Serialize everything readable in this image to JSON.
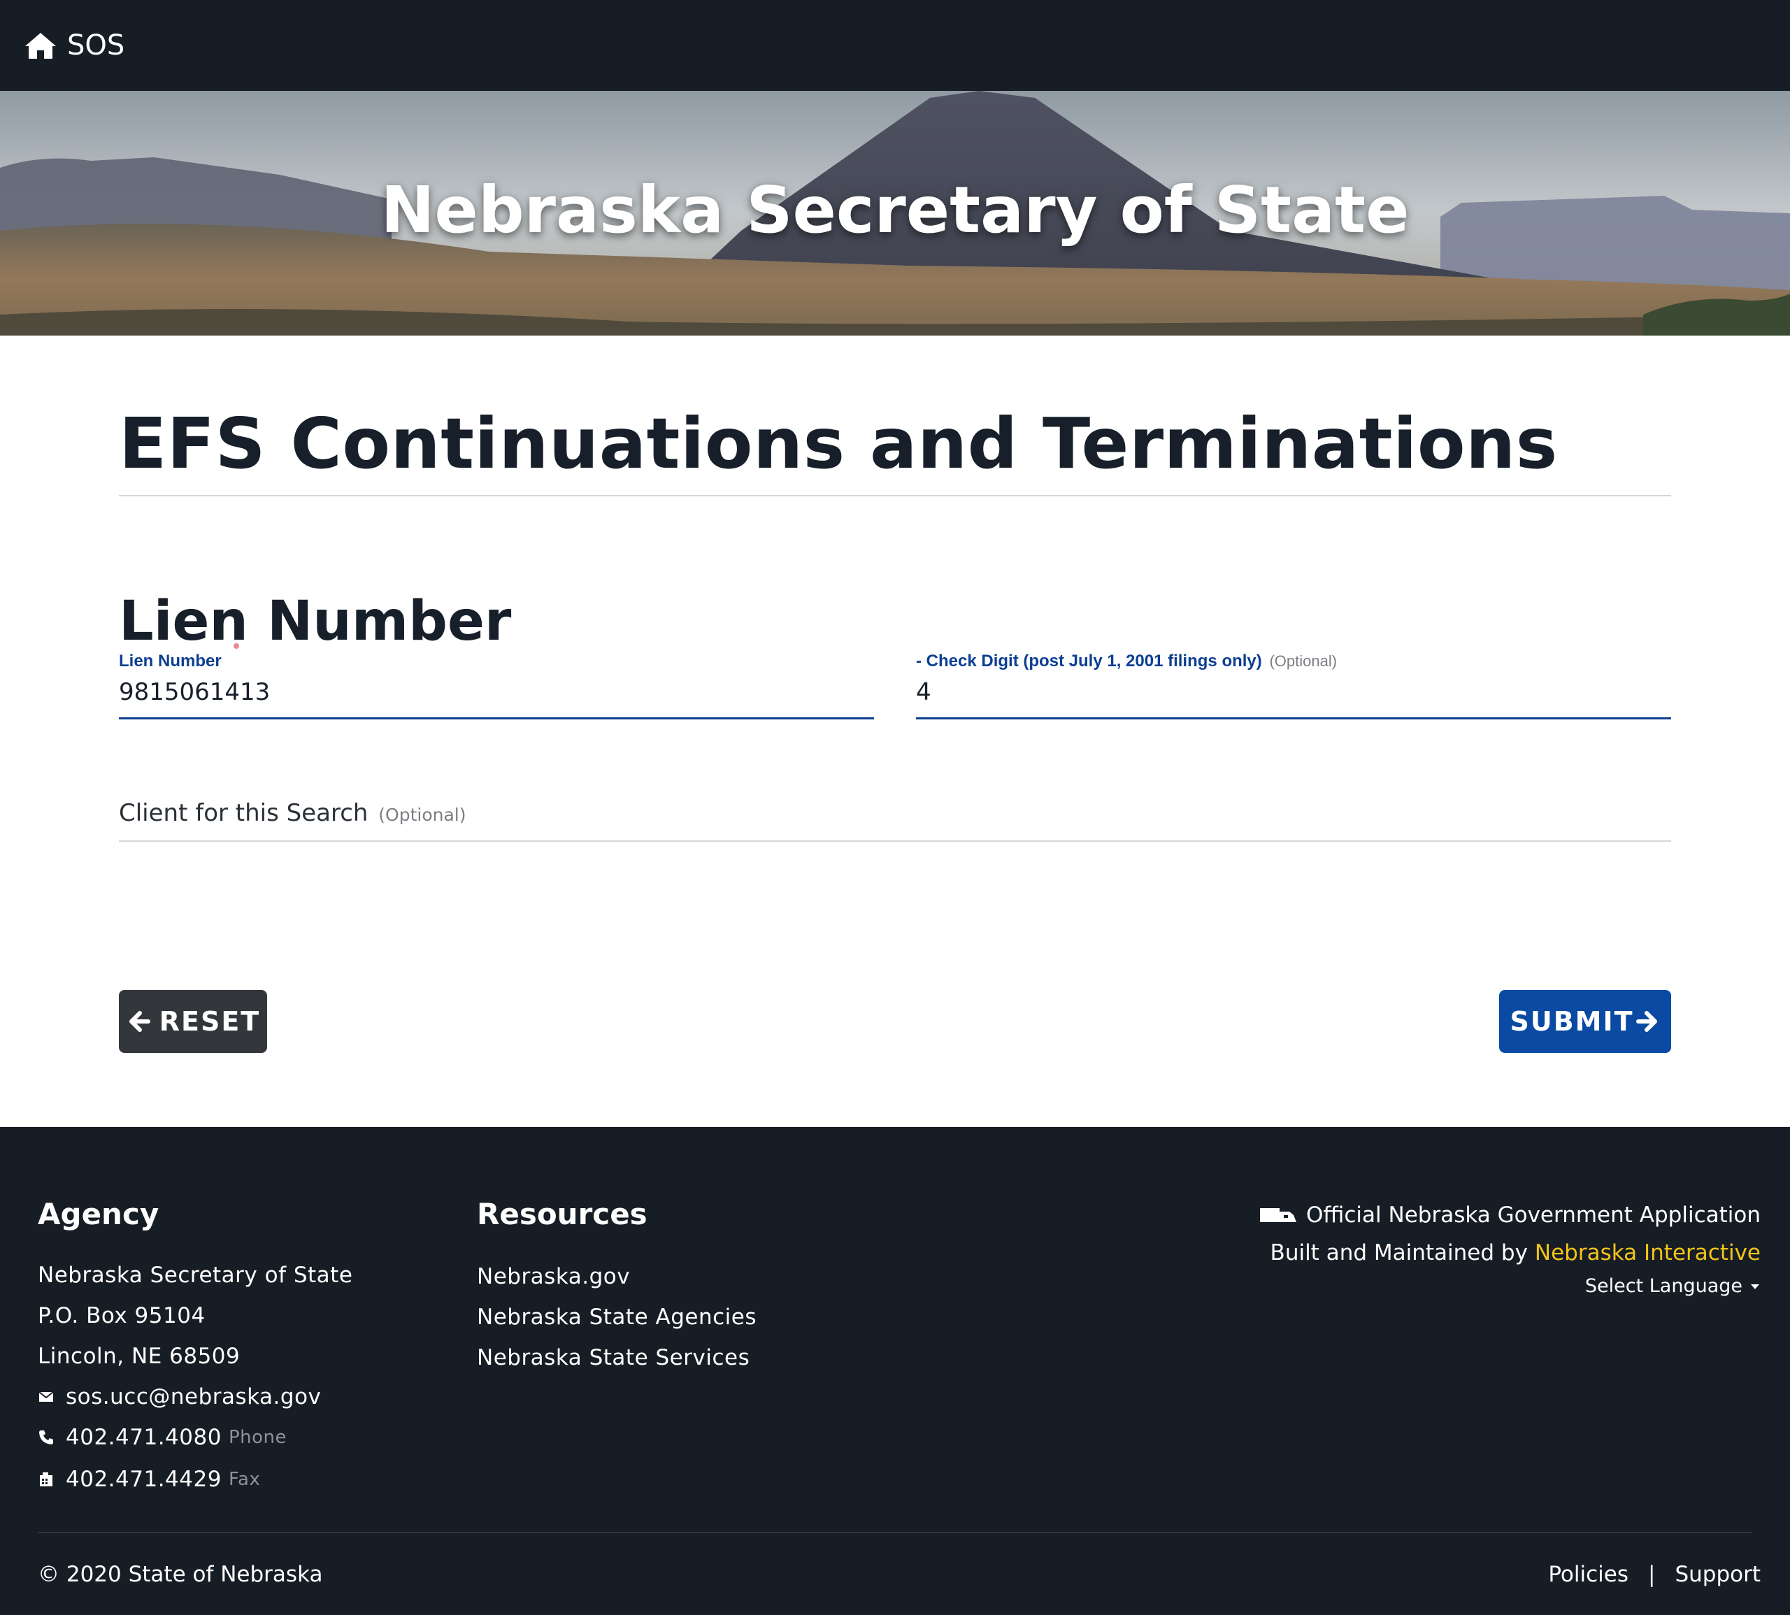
{
  "nav": {
    "home_label": "SOS"
  },
  "hero": {
    "title": "Nebraska Secretary of State"
  },
  "page": {
    "title": "EFS Continuations and Terminations"
  },
  "section": {
    "heading": "Lien Number"
  },
  "form": {
    "lien_number": {
      "label": "Lien Number",
      "value": "9815061413"
    },
    "check_digit": {
      "label": "- Check Digit (post July 1, 2001 filings only)",
      "optional": "(Optional)",
      "value": "4"
    },
    "client": {
      "label": "Client for this Search",
      "optional": "(Optional)",
      "value": ""
    },
    "reset_label": "RESET",
    "submit_label": "SUBMIT"
  },
  "footer": {
    "agency": {
      "heading": "Agency",
      "name": "Nebraska Secretary of State",
      "po_box": "P.O. Box 95104",
      "city": "Lincoln, NE 68509",
      "email": "sos.ucc@nebraska.gov",
      "phone": "402.471.4080",
      "phone_label": "Phone",
      "fax": "402.471.4429",
      "fax_label": "Fax"
    },
    "resources": {
      "heading": "Resources",
      "links": [
        "Nebraska.gov",
        "Nebraska State Agencies",
        "Nebraska State Services"
      ]
    },
    "official": "Official Nebraska Government Application",
    "built_by": "Built and Maintained by",
    "built_by_link": "Nebraska Interactive",
    "select_language": "Select Language",
    "copyright": "© 2020 State of Nebraska",
    "policies": "Policies",
    "separator": "|",
    "support": "Support"
  },
  "colors": {
    "nav_bg": "#171d25",
    "accent_blue": "#0d3f93",
    "submit_blue": "#0b4aa2",
    "reset_gray": "#33363a",
    "link_yellow": "#f5c518"
  }
}
